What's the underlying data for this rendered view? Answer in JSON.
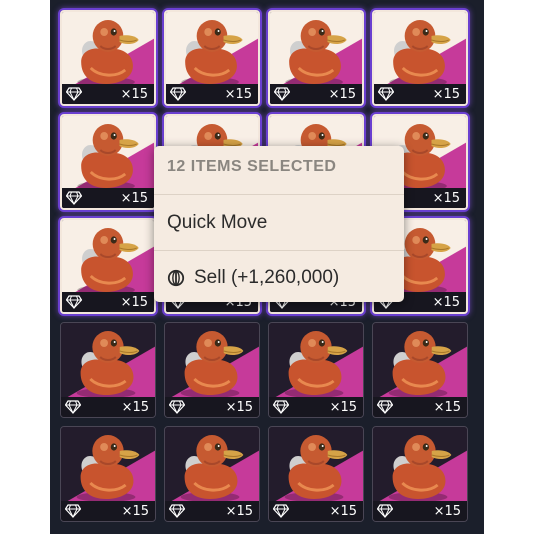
{
  "inventory": {
    "item_name": "duck",
    "rows": [
      [
        {
          "count": "×15",
          "selected": true
        },
        {
          "count": "×15",
          "selected": true
        },
        {
          "count": "×15",
          "selected": true
        },
        {
          "count": "×15",
          "selected": true
        }
      ],
      [
        {
          "count": "×15",
          "selected": true
        },
        {
          "count": "×15",
          "selected": true
        },
        {
          "count": "×15",
          "selected": true
        },
        {
          "count": "×15",
          "selected": true
        }
      ],
      [
        {
          "count": "×15",
          "selected": true
        },
        {
          "count": "×15",
          "selected": true
        },
        {
          "count": "×15",
          "selected": true
        },
        {
          "count": "×15",
          "selected": true
        }
      ],
      [
        {
          "count": "×15",
          "selected": false
        },
        {
          "count": "×15",
          "selected": false
        },
        {
          "count": "×15",
          "selected": false
        },
        {
          "count": "×15",
          "selected": false
        }
      ],
      [
        {
          "count": "×15",
          "selected": false
        },
        {
          "count": "×15",
          "selected": false
        },
        {
          "count": "×15",
          "selected": false
        },
        {
          "count": "×15",
          "selected": false
        }
      ]
    ]
  },
  "context_menu": {
    "header": "12 ITEMS SELECTED",
    "quick_move": "Quick Move",
    "sell": "Sell (+1,260,000)",
    "sell_icon": "currency-coin-icon"
  },
  "colors": {
    "panel_bg": "#1b1f2b",
    "selected_glow": "#6a3fd0",
    "rarity_magenta": "#c63a9a",
    "menu_bg": "#f5ebe1"
  }
}
